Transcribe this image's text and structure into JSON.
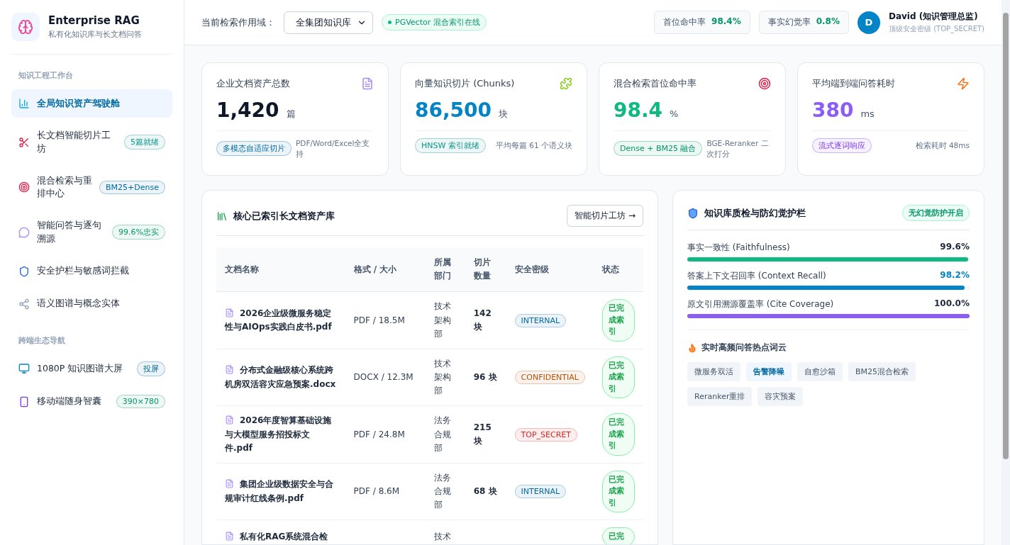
{
  "brand": {
    "title": "Enterprise RAG",
    "subtitle": "私有化知识库与长文档问答"
  },
  "sidebar": {
    "sections": [
      {
        "heading": "知识工程工作台",
        "items": [
          {
            "label": "全局知识资产驾驶舱",
            "selected": true
          },
          {
            "label": "长文档智能切片工坊",
            "selected": false,
            "badge": "5篇就绪"
          },
          {
            "label": "混合检索与重排中心",
            "selected": false,
            "badge": "BM25+Dense"
          },
          {
            "label": "智能问答与逐句溯源",
            "selected": false,
            "badge": "99.6%忠实"
          },
          {
            "label": "安全护栏与敏感词拦截",
            "selected": false
          },
          {
            "label": "语义图谱与概念实体",
            "selected": false
          }
        ]
      },
      {
        "heading": "跨端生态导航",
        "items": [
          {
            "label": "1080P 知识图谱大屏",
            "selected": false,
            "badge": "投屏"
          },
          {
            "label": "移动端随身智囊",
            "selected": false,
            "badge": "390×780"
          }
        ]
      }
    ]
  },
  "topbar": {
    "scope_label": "当前检索作用域：",
    "scope_value": "全集团知识库",
    "status": "PGVector 混合索引在线",
    "metrics": [
      {
        "label": "首位命中率",
        "value": "98.4%"
      },
      {
        "label": "事实幻觉率",
        "value": "0.8%"
      }
    ],
    "user": {
      "initial": "D",
      "name": "David (知识管理总监)",
      "role": "顶级安全密级 (TOP_SECRET)"
    }
  },
  "stats": [
    {
      "title": "企业文档资产总数",
      "value": "1,420",
      "unit": "篇",
      "color": "#0f172a",
      "tag": "多模态自适应切片",
      "note": "PDF/Word/Excel全支持"
    },
    {
      "title": "向量知识切片 (Chunks)",
      "value": "86,500",
      "unit": "块",
      "color": "#0284c7",
      "tag": "HNSW 索引就绪",
      "note": "平均每篇 61 个语义块"
    },
    {
      "title": "混合检索首位命中率",
      "value": "98.4",
      "unit": "%",
      "color": "#10b981",
      "tag": "Dense + BM25 融合",
      "note": "BGE-Reranker 二次打分"
    },
    {
      "title": "平均端到端问答耗时",
      "value": "380",
      "unit": "ms",
      "color": "#8b5cf6",
      "tag": "流式逐词响应",
      "note": "检索耗时 48ms"
    }
  ],
  "library": {
    "title": "核心已索引长文档资产库",
    "action": "智能切片工坊 →",
    "columns": [
      "文档名称",
      "格式 / 大小",
      "所属部门",
      "切片数量",
      "安全密级",
      "状态"
    ],
    "rows": [
      {
        "name": "2026企业级微服务稳定性与AIOps实践白皮书.pdf",
        "format": "PDF / 18.5M",
        "dept": "技术架构部",
        "chunks": "142 块",
        "security": "INTERNAL",
        "kind": "internal",
        "status": "已完成索引"
      },
      {
        "name": "分布式金融级核心系统跨机房双活容灾应急预案.docx",
        "format": "DOCX / 12.3M",
        "dept": "技术架构部",
        "chunks": "96 块",
        "security": "CONFIDENTIAL",
        "kind": "confidential",
        "status": "已完成索引"
      },
      {
        "name": "2026年度智算基础设施与大模型服务招投标文件.pdf",
        "format": "PDF / 24.8M",
        "dept": "法务合规部",
        "chunks": "215 块",
        "security": "TOP_SECRET",
        "kind": "top_secret",
        "status": "已完成索引"
      },
      {
        "name": "集团企业级数据安全与合规审计红线条例.pdf",
        "format": "PDF / 8.6M",
        "dept": "法务合规部",
        "chunks": "68 块",
        "security": "INTERNAL",
        "kind": "internal",
        "status": "已完成索引"
      },
      {
        "name": "私有化RAG系统混合检",
        "dept": "技术",
        "status": "已完"
      }
    ]
  },
  "quality": {
    "title": "知识库质检与防幻觉护栏",
    "badge": "无幻觉防护开启",
    "metrics": [
      {
        "label": "事实一致性 (Faithfulness)",
        "value": "99.6%",
        "level": 0.996,
        "color": "#10b981"
      },
      {
        "label": "答案上下文召回率 (Context Recall)",
        "value": "98.2%",
        "level": 0.982,
        "color": "#0284c7"
      },
      {
        "label": "原文引用溯源覆盖率 (Cite Coverage)",
        "value": "100.0%",
        "level": 1.0,
        "color": "#8b5cf6"
      }
    ],
    "hot_title": "实时高频问答热点词云",
    "hot_words": [
      {
        "text": "微服务双活",
        "highlighted": false
      },
      {
        "text": "告警降噪",
        "highlighted": true
      },
      {
        "text": "自愈沙箱",
        "highlighted": false
      },
      {
        "text": "BM25混合检索",
        "highlighted": false
      },
      {
        "text": "Reranker重排",
        "highlighted": false
      },
      {
        "text": "容灾预案",
        "highlighted": false
      }
    ]
  }
}
